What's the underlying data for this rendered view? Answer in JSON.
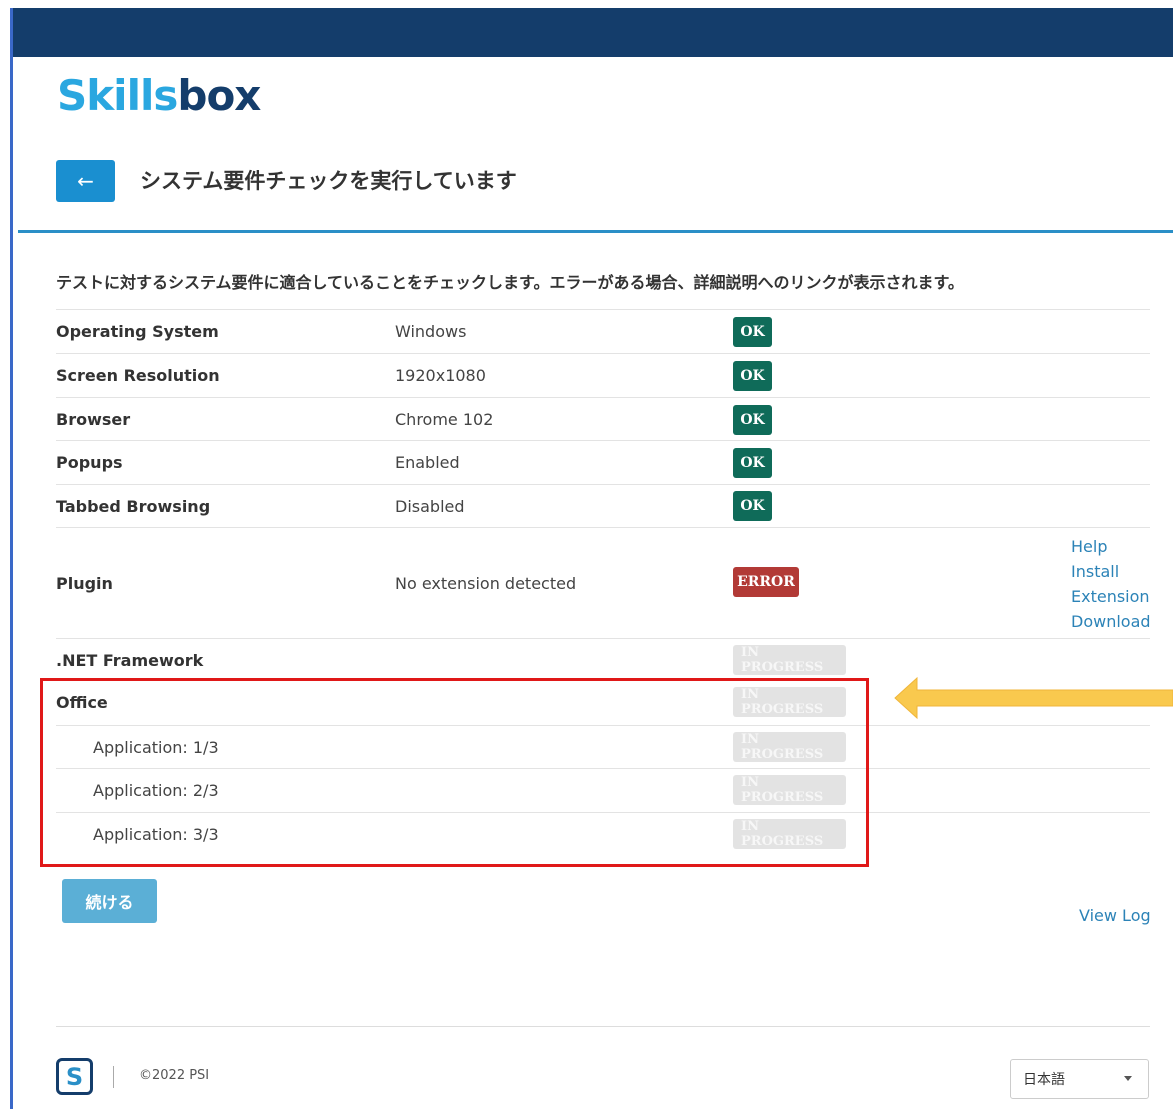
{
  "brand": {
    "logo_part1": "Skills",
    "logo_part2": "box"
  },
  "header": {
    "back_icon": "arrow-left-icon",
    "title": "システム要件チェックを実行しています"
  },
  "intro_text": "テストに対するシステム要件に適合していることをチェックします。エラーがある場合、詳細説明へのリンクが表示されます。",
  "checks": [
    {
      "name": "Operating System",
      "value": "Windows",
      "status": "OK"
    },
    {
      "name": "Screen Resolution",
      "value": "1920x1080",
      "status": "OK"
    },
    {
      "name": "Browser",
      "value": "Chrome 102",
      "status": "OK"
    },
    {
      "name": "Popups",
      "value": "Enabled",
      "status": "OK"
    },
    {
      "name": "Tabbed Browsing",
      "value": "Disabled",
      "status": "OK"
    },
    {
      "name": "Plugin",
      "value": "No extension detected",
      "status": "ERROR",
      "links": [
        "Help",
        "Install",
        "Extension",
        "Download"
      ]
    },
    {
      "name": ".NET Framework",
      "value": "",
      "status": "IN PROGRESS"
    },
    {
      "name": "Office",
      "value": "",
      "status": "IN PROGRESS"
    },
    {
      "name": "Application: 1/3",
      "value": "",
      "status": "IN PROGRESS"
    },
    {
      "name": "Application: 2/3",
      "value": "",
      "status": "IN PROGRESS"
    },
    {
      "name": "Application: 3/3",
      "value": "",
      "status": "IN PROGRESS"
    }
  ],
  "colors": {
    "ok": "#0f6b59",
    "error": "#b23a36",
    "in_progress": "#e3e3e3",
    "highlight_box": "#e01818",
    "arrow": "#f9c94e",
    "top_bar": "#143d6b"
  },
  "continue_label": "続ける",
  "view_log_label": "View Log",
  "footer": {
    "logo_letter": "S",
    "copyright": "©2022 PSI",
    "language": "日本語"
  }
}
